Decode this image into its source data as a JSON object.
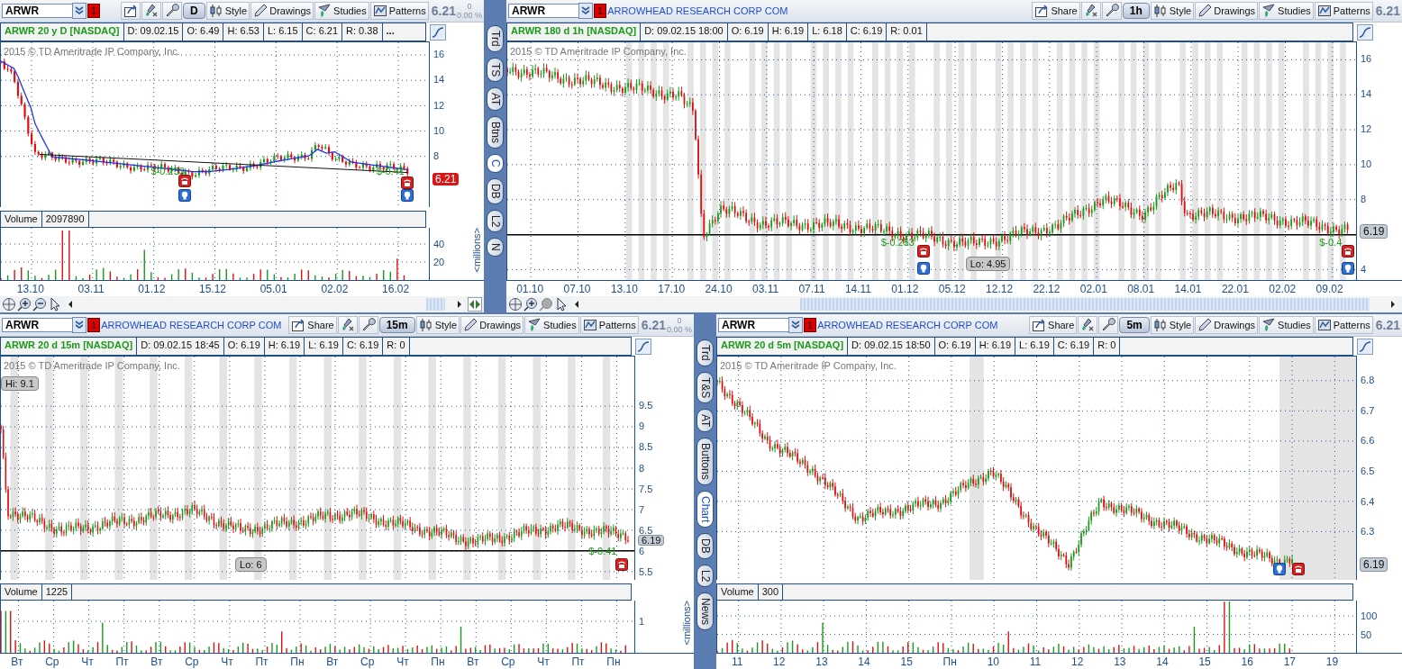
{
  "charts": [
    {
      "symbol": "ARWR",
      "alert_count": "1",
      "period": "D",
      "tools": [
        "Style",
        "Drawings",
        "Studies",
        "Patterns"
      ],
      "last": "6.21",
      "change": "0",
      "change_pct": "0.00 %",
      "title": "ARWR 20 y D [NASDAQ]",
      "quote": [
        "D: 09.02.15",
        "O: 6.49",
        "H: 6.53",
        "L: 6.15",
        "C: 6.21",
        "R: 0.38"
      ],
      "more": "...",
      "watermark": "2015 © TD Ameritrade IP Company, Inc.",
      "price_ticks": [
        "16",
        "14",
        "12",
        "10",
        "8"
      ],
      "price_tag": {
        "text": "6.21",
        "kind": "alert"
      },
      "annotations": [
        {
          "kind": "change",
          "text": "$-0.253"
        },
        {
          "kind": "change",
          "text": "$-0.41"
        }
      ],
      "volume": {
        "label": "Volume",
        "value": "2097890",
        "ticks": [
          "40",
          "20"
        ],
        "unit": "<millions>"
      },
      "x_ticks": [
        "13.10",
        "03.11",
        "01.12",
        "15.12",
        "05.01",
        "02.02",
        "16.02"
      ]
    },
    {
      "symbol": "ARWR",
      "alert_count": "1",
      "company": "ARROWHEAD RESEARCH CORP COM",
      "share": "Share",
      "period": "1h",
      "tools": [
        "Style",
        "Drawings",
        "Studies",
        "Patterns"
      ],
      "last": "6.21",
      "title": "ARWR 180 d 1h [NASDAQ]",
      "quote": [
        "D: 09.02.15 18:00",
        "O: 6.19",
        "H: 6.19",
        "L: 6.18",
        "C: 6.19",
        "R: 0.01"
      ],
      "watermark": "2015 © TD Ameritrade IP Company, Inc.",
      "price_ticks": [
        "16",
        "14",
        "12",
        "10",
        "8",
        "4"
      ],
      "price_tag": {
        "text": "6.19",
        "kind": "last"
      },
      "annotations": [
        {
          "kind": "change",
          "text": "$-0.253"
        },
        {
          "kind": "callout",
          "text": "Lo: 4.95"
        },
        {
          "kind": "change",
          "text": "$-0.4"
        }
      ],
      "x_ticks": [
        "01.10",
        "07.10",
        "13.10",
        "17.10",
        "24.10",
        "03.11",
        "07.11",
        "14.11",
        "01.12",
        "05.12",
        "12.12",
        "22.12",
        "02.01",
        "08.01",
        "14.01",
        "22.01",
        "02.02",
        "09.02"
      ]
    },
    {
      "symbol": "ARWR",
      "alert_count": "1",
      "company": "ARROWHEAD RESEARCH CORP COM",
      "share": "Share",
      "period": "15m",
      "tools": [
        "Style",
        "Drawings",
        "Studies",
        "Patterns"
      ],
      "last": "6.21",
      "change": "0",
      "change_pct": "0.00 %",
      "title": "ARWR 20 d 15m [NASDAQ]",
      "quote": [
        "D: 09.02.15 18:45",
        "O: 6.19",
        "H: 6.19",
        "L: 6.19",
        "C: 6.19",
        "R: 0"
      ],
      "watermark": "2015 © TD Ameritrade IP Company, Inc.",
      "price_ticks": [
        "9.5",
        "9",
        "8.5",
        "8",
        "7.5",
        "7",
        "6.5",
        "6",
        "5.5"
      ],
      "price_tag": {
        "text": "6.19",
        "kind": "last"
      },
      "annotations": [
        {
          "kind": "callout",
          "text": "Hi: 9.1"
        },
        {
          "kind": "callout",
          "text": "Lo: 6"
        },
        {
          "kind": "change",
          "text": "$-0.41"
        }
      ],
      "volume": {
        "label": "Volume",
        "value": "1225",
        "ticks": [
          "1"
        ],
        "unit": "<millions>"
      },
      "x_ticks": [
        "Вт",
        "Ср",
        "Чт",
        "Пт",
        "Вт",
        "Ср",
        "Чт",
        "Пт",
        "Пн",
        "Вт",
        "Ср",
        "Чт",
        "Пн",
        "Вт",
        "Ср",
        "Чт",
        "Пт",
        "Пн"
      ]
    },
    {
      "symbol": "ARWR",
      "alert_count": "1",
      "company": "ARROWHEAD RESEARCH CORP COM",
      "share": "Share",
      "period": "5m",
      "tools": [
        "Style",
        "Drawings",
        "Studies",
        "Patterns"
      ],
      "last": "6.21",
      "title": "ARWR 20 d 5m [NASDAQ]",
      "quote": [
        "D: 09.02.15 18:50",
        "O: 6.19",
        "H: 6.19",
        "L: 6.19",
        "C: 6.19",
        "R: 0"
      ],
      "watermark": "2015 © TD Ameritrade IP Company, Inc.",
      "price_ticks": [
        "6.8",
        "6.7",
        "6.6",
        "6.5",
        "6.4",
        "6.3"
      ],
      "price_tag": {
        "text": "6.19",
        "kind": "last"
      },
      "volume": {
        "label": "Volume",
        "value": "300",
        "ticks": [
          "100",
          "50"
        ]
      },
      "x_ticks": [
        "11",
        "12",
        "13",
        "14",
        "15",
        "Пн",
        "10",
        "11",
        "12",
        "13",
        "14",
        "15",
        "16",
        "17",
        "19"
      ]
    }
  ],
  "side_bars": [
    {
      "tabs": [
        {
          "label": "Trd",
          "selected": false
        },
        {
          "label": "TS",
          "selected": false
        },
        {
          "label": "AT",
          "selected": false
        },
        {
          "label": "Btns",
          "selected": false
        },
        {
          "label": "C",
          "selected": true
        },
        {
          "label": "DB",
          "selected": false
        },
        {
          "label": "L2",
          "selected": false
        },
        {
          "label": "N",
          "selected": false
        }
      ]
    },
    {
      "tabs": [
        {
          "label": "Trd",
          "selected": false
        },
        {
          "label": "T&S",
          "selected": false
        },
        {
          "label": "AT",
          "selected": false
        },
        {
          "label": "Buttons",
          "selected": false
        },
        {
          "label": "Chart",
          "selected": true
        },
        {
          "label": "DB",
          "selected": false
        },
        {
          "label": "L2",
          "selected": false
        },
        {
          "label": "News",
          "selected": false
        }
      ]
    }
  ]
}
